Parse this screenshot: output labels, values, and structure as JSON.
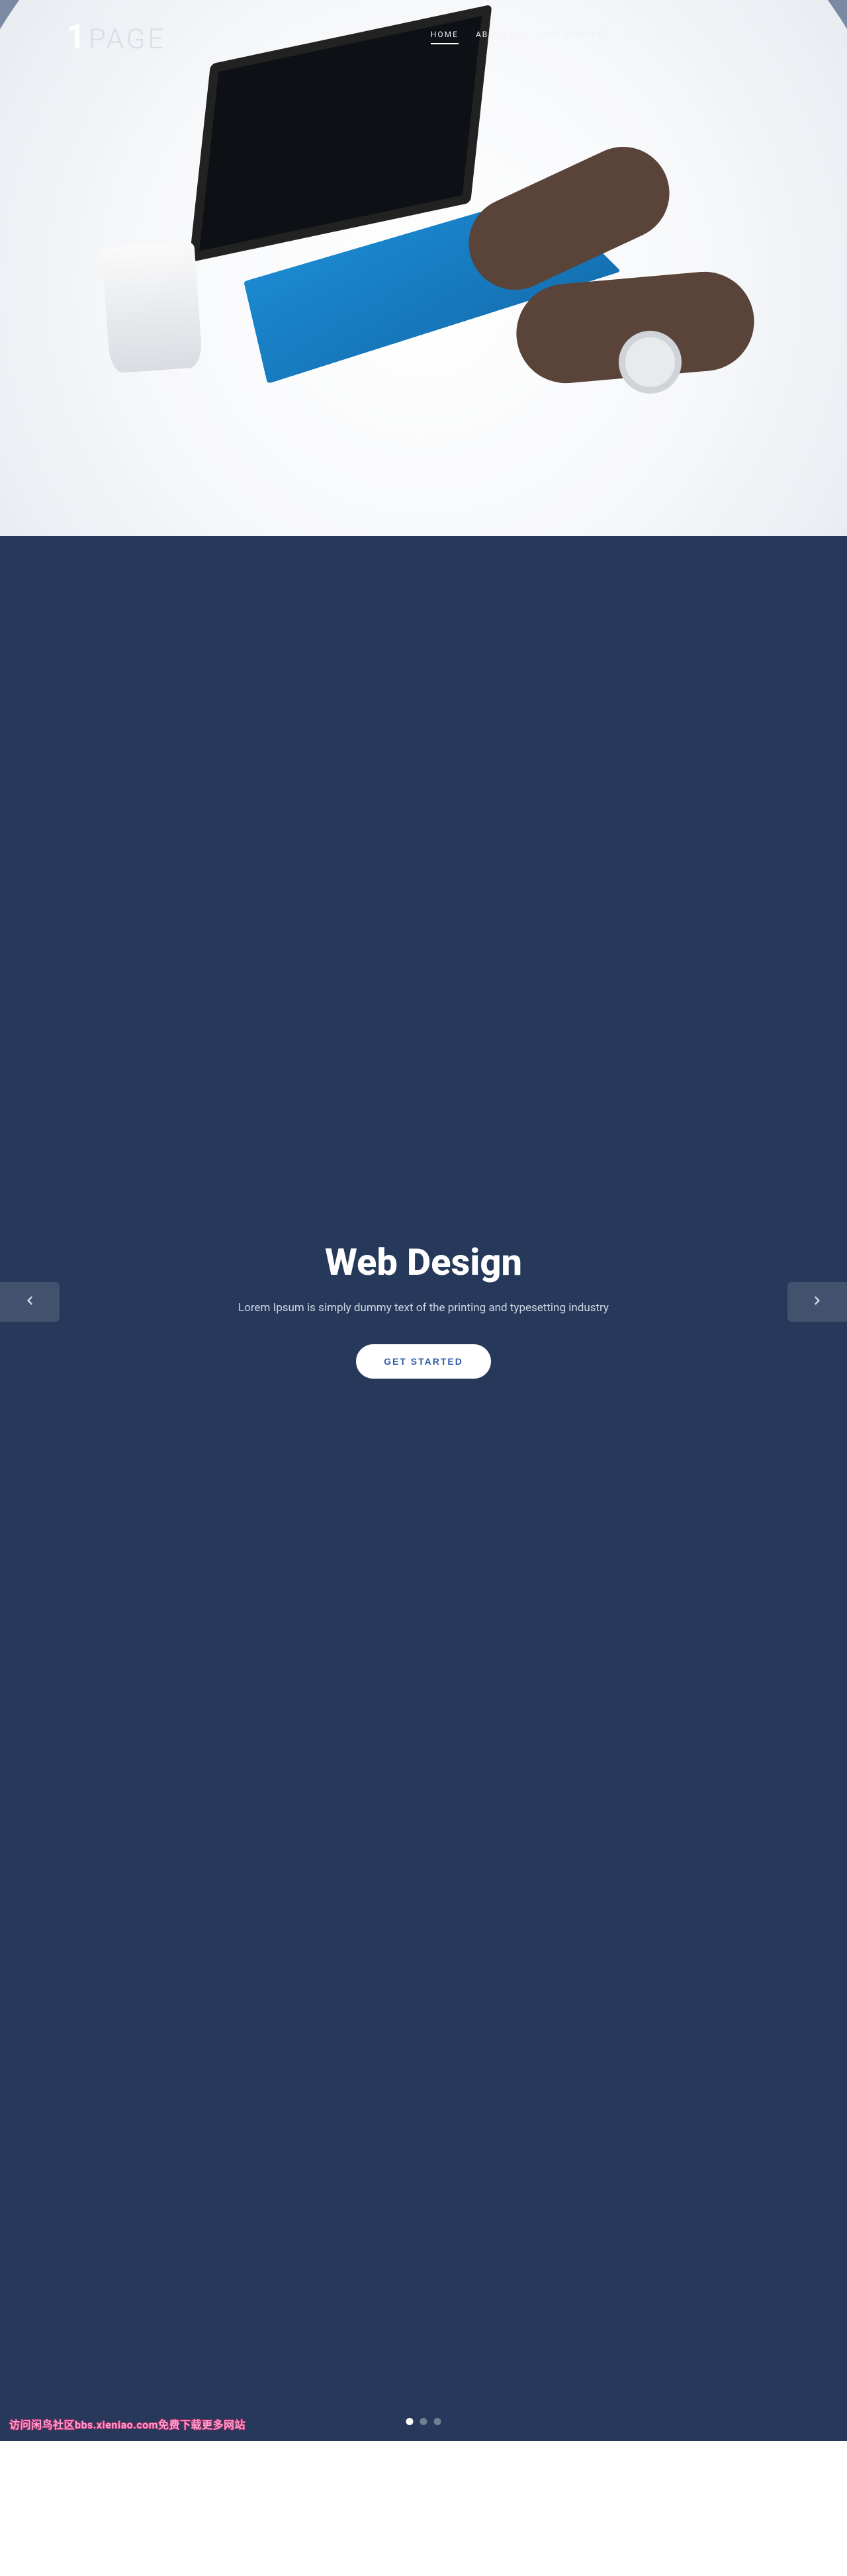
{
  "brand": {
    "mark": "1",
    "word": "PAGE"
  },
  "nav": {
    "items": [
      {
        "label": "HOME",
        "active": true
      },
      {
        "label": "ABOUT US",
        "active": false
      },
      {
        "label": "OUR SERVICES",
        "active": false
      },
      {
        "label": "OUR PORTFOLIO",
        "active": false
      },
      {
        "label": "CONTACT US",
        "active": false
      }
    ]
  },
  "slider": {
    "title": "Web Design",
    "subtitle": "Lorem Ipsum is simply dummy text of the printing and typesetting industry",
    "cta": "GET STARTED",
    "active_dot": 0,
    "dot_count": 3
  },
  "watermark": "访问闲鸟社区bbs.xieniao.com免费下载更多网站"
}
